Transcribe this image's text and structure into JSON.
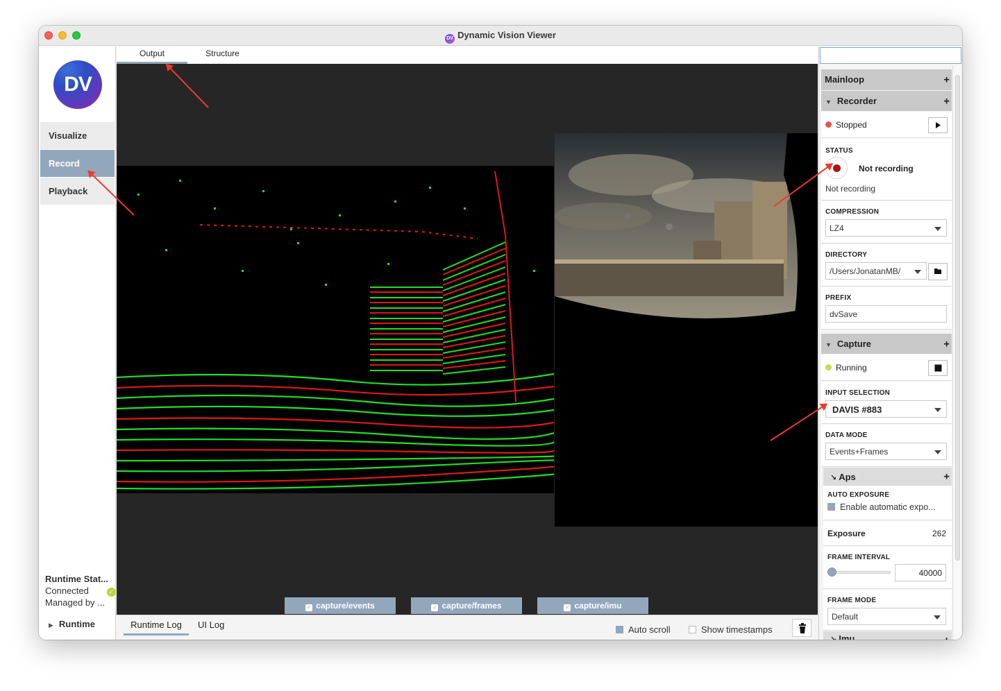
{
  "window": {
    "title": "Dynamic Vision Viewer",
    "title_badge": "DV"
  },
  "sidebar": {
    "logo_text": "DV",
    "nav": [
      {
        "label": "Visualize",
        "active": false
      },
      {
        "label": "Record",
        "active": true
      },
      {
        "label": "Playback",
        "active": false
      }
    ],
    "runtime_status": {
      "title": "Runtime Stat...",
      "connected": "Connected",
      "managed": "Managed by ..."
    },
    "runtime_tree_label": "Runtime"
  },
  "main": {
    "tabs": [
      {
        "label": "Output",
        "active": true
      },
      {
        "label": "Structure",
        "active": false
      }
    ],
    "stream_tabs": [
      {
        "label": "capture/events"
      },
      {
        "label": "capture/frames"
      },
      {
        "label": "capture/imu"
      }
    ]
  },
  "log": {
    "tabs": [
      {
        "label": "Runtime Log",
        "active": true
      },
      {
        "label": "UI Log",
        "active": false
      }
    ],
    "auto_scroll": {
      "label": "Auto scroll",
      "checked": true
    },
    "show_timestamps": {
      "label": "Show timestamps",
      "checked": false
    }
  },
  "panel": {
    "mainloop": "Mainloop",
    "recorder": {
      "title": "Recorder",
      "state": "Stopped",
      "state_color": "#e8544c",
      "status_label": "STATUS",
      "status_text": "Not recording",
      "status_subtext": "Not recording",
      "compression_label": "COMPRESSION",
      "compression_value": "LZ4",
      "directory_label": "DIRECTORY",
      "directory_value": "/Users/JonatanMB/",
      "prefix_label": "PREFIX",
      "prefix_value": "dvSave"
    },
    "capture": {
      "title": "Capture",
      "state": "Running",
      "state_color": "#c3e050",
      "input_label": "INPUT SELECTION",
      "input_value": "DAVIS #883",
      "data_mode_label": "DATA MODE",
      "data_mode_value": "Events+Frames"
    },
    "aps": {
      "title": "Aps",
      "auto_exposure_label": "AUTO EXPOSURE",
      "auto_exposure_checkbox": "Enable automatic expo...",
      "auto_exposure_checked": true,
      "exposure_label": "Exposure",
      "exposure_value": "262",
      "frame_interval_label": "FRAME INTERVAL",
      "frame_interval_value": "40000",
      "frame_mode_label": "FRAME MODE",
      "frame_mode_value": "Default"
    },
    "next_section_partial": "Imu"
  },
  "colors": {
    "accent": "#93a7bc",
    "event_on": "#22e022",
    "event_off": "#e01818",
    "annotation": "#ee3a2a"
  }
}
